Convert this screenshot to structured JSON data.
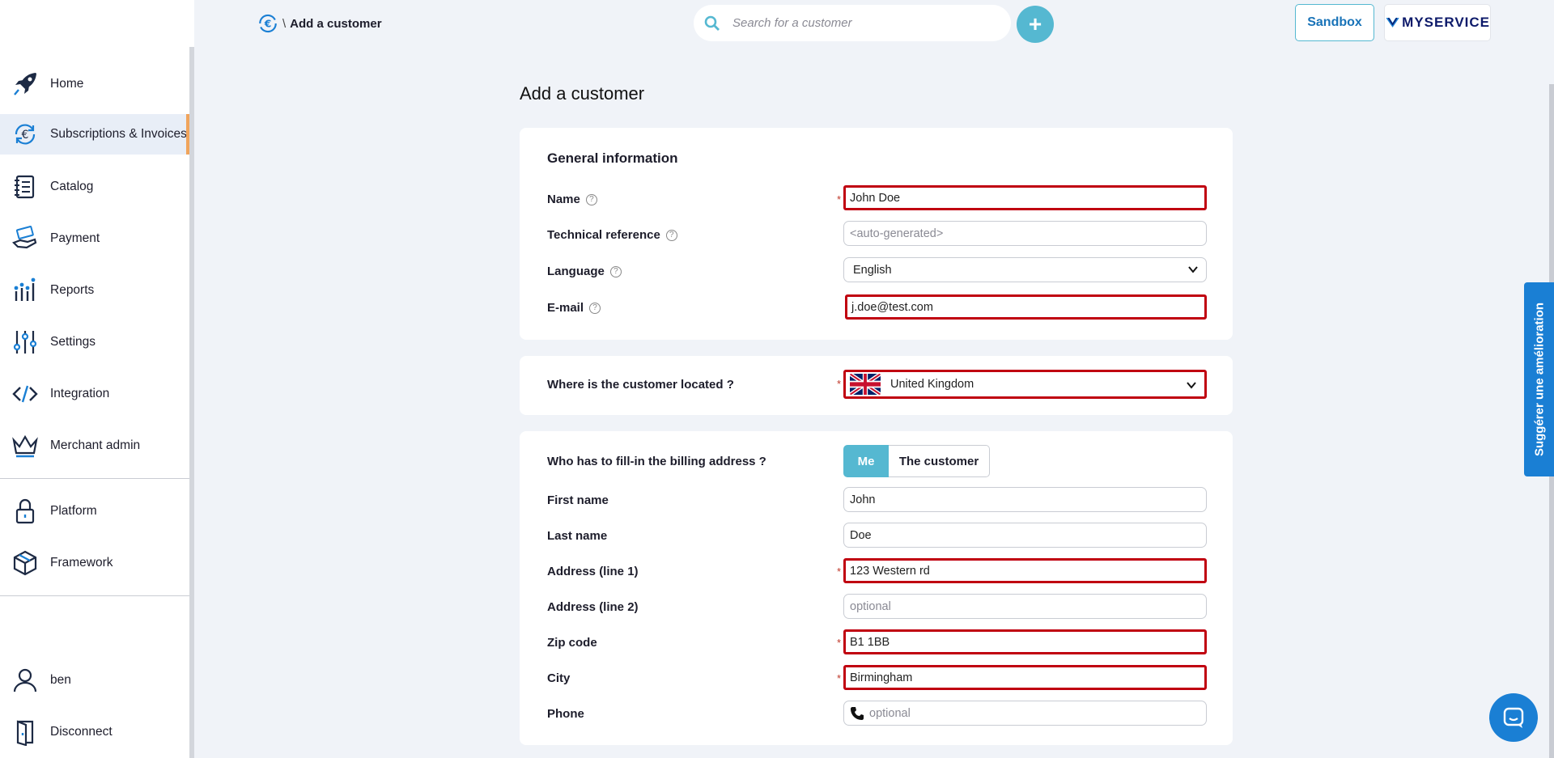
{
  "sidebar": {
    "items": [
      {
        "label": "Home",
        "icon": "rocket-icon"
      },
      {
        "label": "Subscriptions & Invoices",
        "icon": "euro-cycle-icon"
      },
      {
        "label": "Catalog",
        "icon": "notebook-icon"
      },
      {
        "label": "Payment",
        "icon": "hand-money-icon"
      },
      {
        "label": "Reports",
        "icon": "bar-chart-icon"
      },
      {
        "label": "Settings",
        "icon": "sliders-icon"
      },
      {
        "label": "Integration",
        "icon": "code-icon"
      },
      {
        "label": "Merchant admin",
        "icon": "crown-icon"
      },
      {
        "label": "Platform",
        "icon": "lock-icon"
      },
      {
        "label": "Framework",
        "icon": "cube-icon"
      },
      {
        "label": "ben",
        "icon": "user-icon"
      },
      {
        "label": "Disconnect",
        "icon": "door-icon"
      }
    ],
    "active_color": "#f0a45c"
  },
  "header": {
    "breadcrumb_sep": "\\",
    "breadcrumb_current": "Add a customer",
    "search_placeholder": "Search for a customer",
    "add_label": "+",
    "sandbox_label": "Sandbox",
    "brand_label": "MYSERVICE",
    "accent": "#55b8d1"
  },
  "main": {
    "title": "Add a customer",
    "general": {
      "title": "General information",
      "name_label": "Name",
      "name_value": "John Doe",
      "techref_label": "Technical reference",
      "techref_placeholder": "<auto-generated>",
      "language_label": "Language",
      "language_value": "English",
      "email_label": "E-mail",
      "email_value": "j.doe@test.com"
    },
    "location": {
      "label": "Where is the customer located ?",
      "country": "United Kingdom"
    },
    "billing": {
      "who_label": "Who has to fill-in the billing address ?",
      "opt_me": "Me",
      "opt_customer": "The customer",
      "first_name_label": "First name",
      "first_name_value": "John",
      "last_name_label": "Last name",
      "last_name_value": "Doe",
      "addr1_label": "Address (line 1)",
      "addr1_value": "123 Western rd",
      "addr2_label": "Address (line 2)",
      "addr2_placeholder": "optional",
      "zip_label": "Zip code",
      "zip_value": "B1 1BB",
      "city_label": "City",
      "city_value": "Birmingham",
      "phone_label": "Phone",
      "phone_placeholder": "optional"
    },
    "required_mark": "*",
    "error_color": "#c00010"
  },
  "feedback_label": "Suggérer une amélioration"
}
